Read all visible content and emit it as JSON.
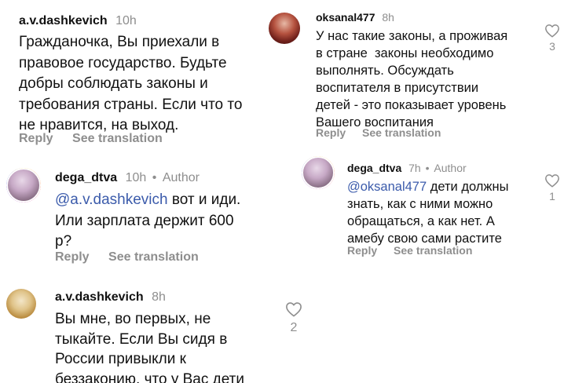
{
  "left": {
    "comment1": {
      "username": "a.v.dashkevich",
      "time": "10h",
      "lines": [
        "Гражданочка, Вы приехали в",
        "правовое государство. Будьте",
        "добры соблюдать законы и",
        "требования страны. Если что то",
        "не нравится, на выход."
      ],
      "reply_label": "Reply",
      "translate_label": "See translation"
    },
    "comment2": {
      "username": "dega_dtva",
      "time": "10h",
      "separator": "•",
      "badge": "Author",
      "mention": "@a.v.dashkevich",
      "first_line_rest": " вот и иди.",
      "lines": [
        "Или зарплата держит 600",
        "р?"
      ],
      "reply_label": "Reply",
      "translate_label": "See translation"
    },
    "comment3": {
      "username": "a.v.dashkevich",
      "time": "8h",
      "lines": [
        "Вы мне, во первых, не",
        "тыкайте. Если Вы сидя в",
        "России привыкли к",
        "беззаконию, что у Вас дети"
      ],
      "like_count": "2"
    }
  },
  "right": {
    "comment1": {
      "username": "oksanal477",
      "time": "8h",
      "lines": [
        "У нас такие законы, а проживая",
        "в стране  законы необходимо",
        "выполнять. Обсуждать",
        "воспитателя в присутствии",
        "детей - это показывает уровень",
        "Вашего воспитания"
      ],
      "reply_label": "Reply",
      "translate_label": "See translation",
      "like_count": "3"
    },
    "comment2": {
      "username": "dega_dtva",
      "time": "7h",
      "separator": "•",
      "badge": "Author",
      "mention": "@oksanal477",
      "first_line_rest": " дети должны",
      "lines": [
        "знать, как с ними можно",
        "обращаться, а как нет. А",
        "амебу свою сами растите"
      ],
      "reply_label": "Reply",
      "translate_label": "See translation",
      "like_count": "1"
    }
  },
  "icons": {
    "like": "heart-outline-icon"
  },
  "colors": {
    "meta": "#8e8e8e",
    "mention": "#3b5bab",
    "text": "#111111"
  }
}
